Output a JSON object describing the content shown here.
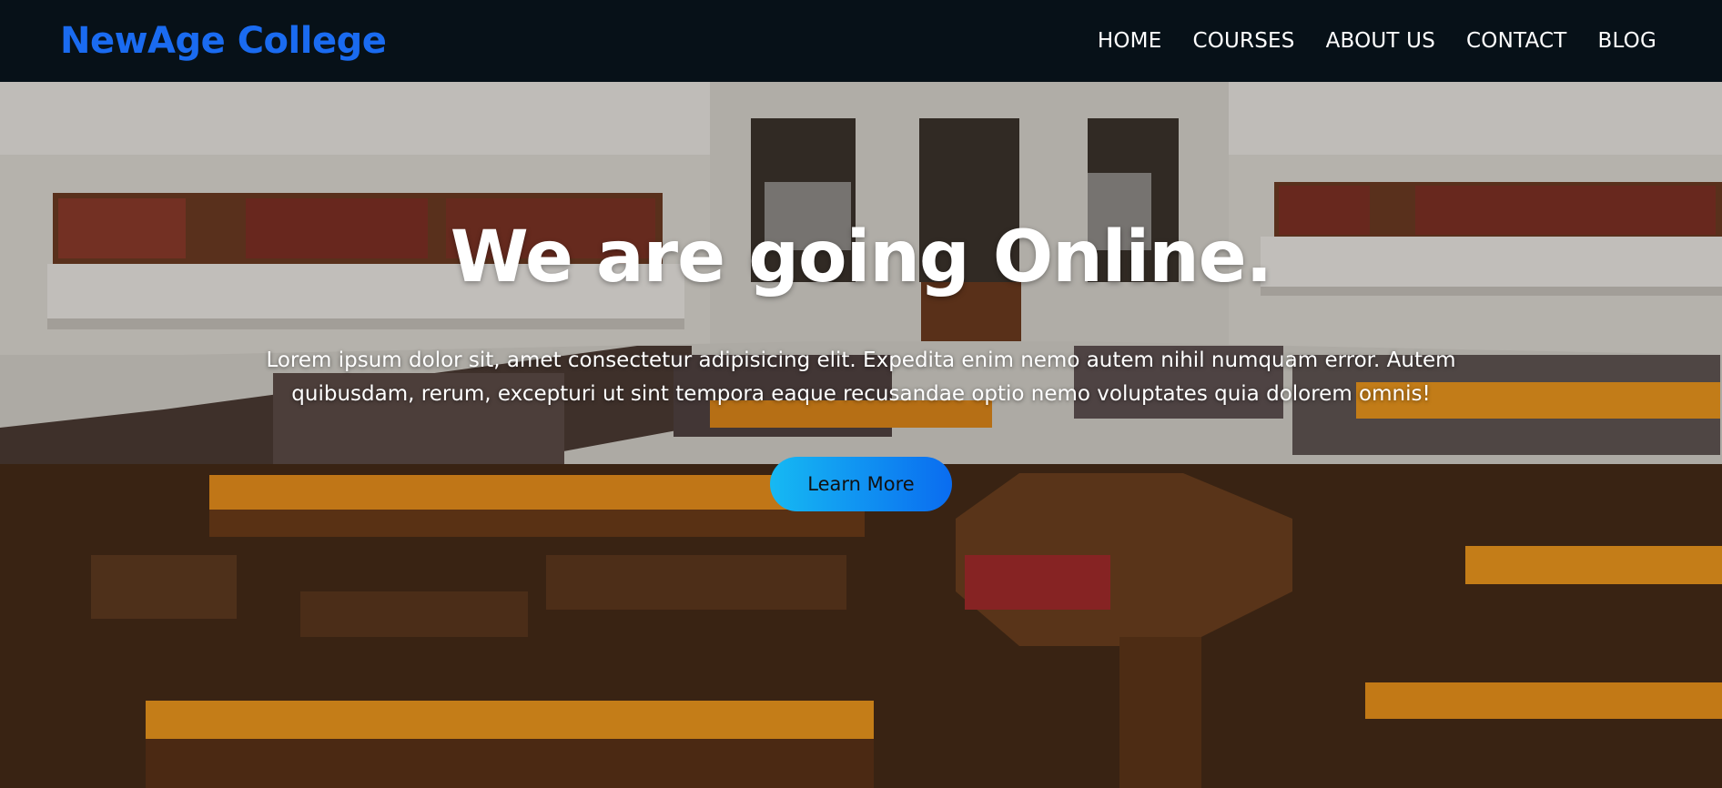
{
  "nav": {
    "brand": "NewAge College",
    "links": [
      "HOME",
      "COURSES",
      "ABOUT US",
      "CONTACT",
      "BLOG"
    ]
  },
  "hero": {
    "title": "We are going Online.",
    "text": "Lorem ipsum dolor sit, amet consectetur adipisicing elit. Expedita enim nemo autem nihil numquam error. Autem quibusdam, rerum, excepturi ut sint tempora eaque recusandae optio nemo voluptates quia dolorem omnis!",
    "cta_label": "Learn More"
  },
  "colors": {
    "nav_bg": "#071118",
    "brand": "#1a6bf0",
    "cta_start": "#16b9f3",
    "cta_end": "#0a6cf0"
  }
}
